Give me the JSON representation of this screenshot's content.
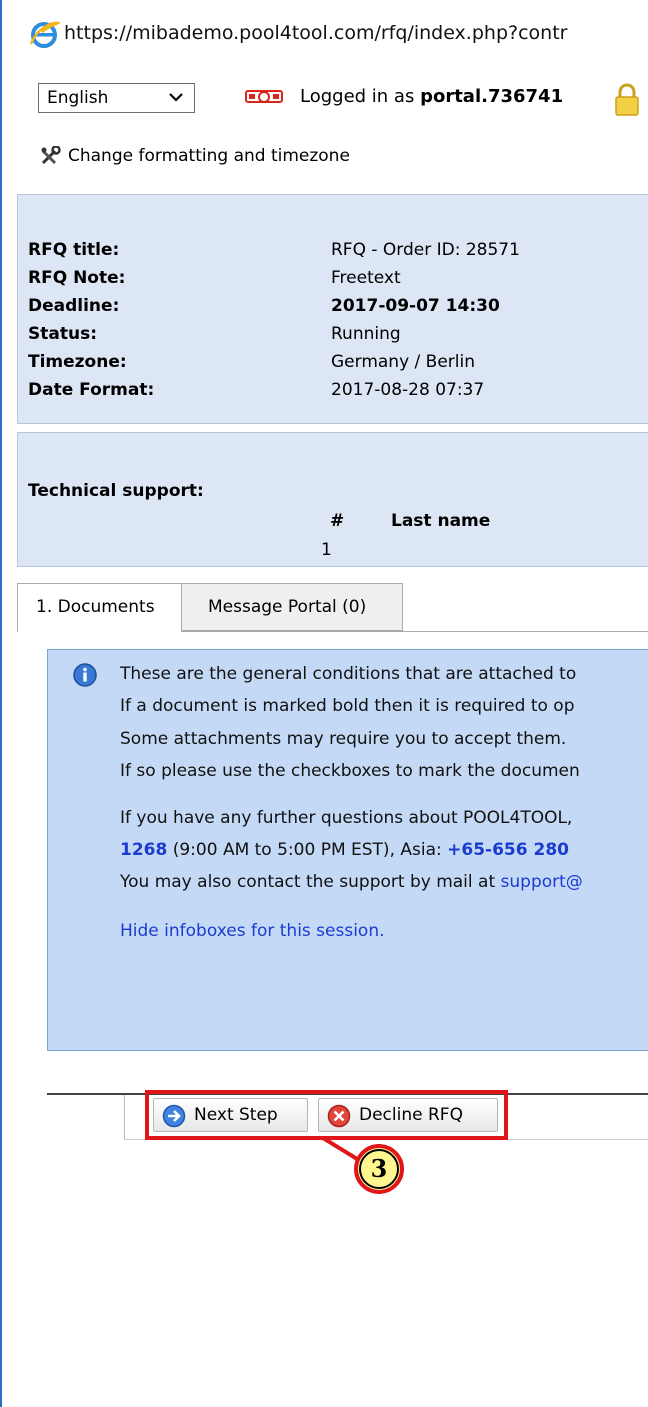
{
  "address_bar": {
    "url": "https://mibademo.pool4tool.com/rfq/index.php?contr"
  },
  "toolbar": {
    "language": "English",
    "logged_in_prefix": "Logged in as ",
    "username": "portal.736741",
    "change_format": "Change formatting and timezone"
  },
  "rfq_info": [
    {
      "label": "RFQ title:",
      "value": "RFQ - Order ID: 28571"
    },
    {
      "label": "RFQ Note:",
      "value": "Freetext"
    },
    {
      "label": "Deadline:",
      "value": "2017-09-07 14:30"
    },
    {
      "label": "Status:",
      "value": "Running"
    },
    {
      "label": "Timezone:",
      "value": "Germany / Berlin"
    },
    {
      "label": "Date Format:",
      "value": "2017-08-28 07:37"
    }
  ],
  "support": {
    "label": "Technical support:",
    "col_num": "#",
    "col_lastname": "Last name",
    "row_num": "1"
  },
  "tabs": [
    {
      "label": "1. Documents"
    },
    {
      "label": "Message Portal (0)"
    }
  ],
  "infobox": {
    "lines": [
      "These are the general conditions that are attached to",
      "If a document is marked bold then it is required to op",
      "Some attachments may require you to accept them.",
      "If so please use the checkboxes to mark the documen",
      "If you have any further questions about POOL4TOOL,"
    ],
    "phone1": "1268",
    "hours": " (9:00 AM to 5:00 PM EST), Asia: ",
    "phone2": "+65-656 280",
    "mail_prefix": "You may also contact the support by mail at ",
    "mail": "support@",
    "hide_link": "Hide infoboxes for this session."
  },
  "buttons": {
    "next": "Next Step",
    "decline": "Decline RFQ"
  },
  "callout": {
    "number": "3"
  },
  "colors": {
    "panel": "#dde6f5",
    "infobox": "#c4d9f6",
    "link": "#1a3ccf",
    "highlight": "#e0161b",
    "callout_fill": "#fff68f"
  }
}
